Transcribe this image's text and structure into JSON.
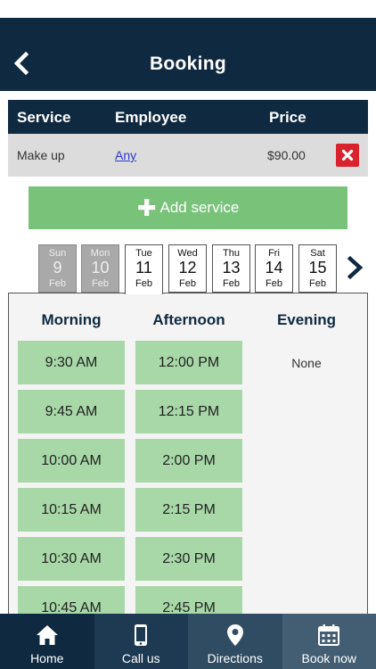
{
  "header": {
    "title": "Booking",
    "back_icon": "chevron-left-icon"
  },
  "services_table": {
    "headers": {
      "service": "Service",
      "employee": "Employee",
      "price": "Price"
    },
    "rows": [
      {
        "service": "Make up",
        "employee": "Any",
        "price": "$90.00",
        "remove_icon": "close-icon"
      }
    ]
  },
  "add_service": {
    "label": "Add service",
    "icon": "plus-icon"
  },
  "dates": [
    {
      "weekday": "Sun",
      "day": "9",
      "month": "Feb",
      "state": "past"
    },
    {
      "weekday": "Mon",
      "day": "10",
      "month": "Feb",
      "state": "past"
    },
    {
      "weekday": "Tue",
      "day": "11",
      "month": "Feb",
      "state": "selected"
    },
    {
      "weekday": "Wed",
      "day": "12",
      "month": "Feb",
      "state": "available"
    },
    {
      "weekday": "Thu",
      "day": "13",
      "month": "Feb",
      "state": "available"
    },
    {
      "weekday": "Fri",
      "day": "14",
      "month": "Feb",
      "state": "available"
    },
    {
      "weekday": "Sat",
      "day": "15",
      "month": "Feb",
      "state": "available"
    }
  ],
  "next_dates_icon": "chevron-right-icon",
  "time_columns": {
    "morning": {
      "label": "Morning",
      "slots": [
        "9:30 AM",
        "9:45 AM",
        "10:00 AM",
        "10:15 AM",
        "10:30 AM",
        "10:45 AM"
      ]
    },
    "afternoon": {
      "label": "Afternoon",
      "slots": [
        "12:00 PM",
        "12:15 PM",
        "2:00 PM",
        "2:15 PM",
        "2:30 PM",
        "2:45 PM"
      ]
    },
    "evening": {
      "label": "Evening",
      "empty_text": "None"
    }
  },
  "colors": {
    "navy": "#0f2940",
    "slot_green": "#a8d8a8",
    "add_green": "#78c379",
    "remove_red": "#d8232f"
  },
  "bottom_nav": [
    {
      "label": "Home",
      "icon": "home-icon",
      "color": "#0f2940"
    },
    {
      "label": "Call us",
      "icon": "phone-icon",
      "color": "#1e3a52"
    },
    {
      "label": "Directions",
      "icon": "map-pin-icon",
      "color": "#304c63"
    },
    {
      "label": "Book now",
      "icon": "calendar-icon",
      "color": "#435e73"
    }
  ]
}
